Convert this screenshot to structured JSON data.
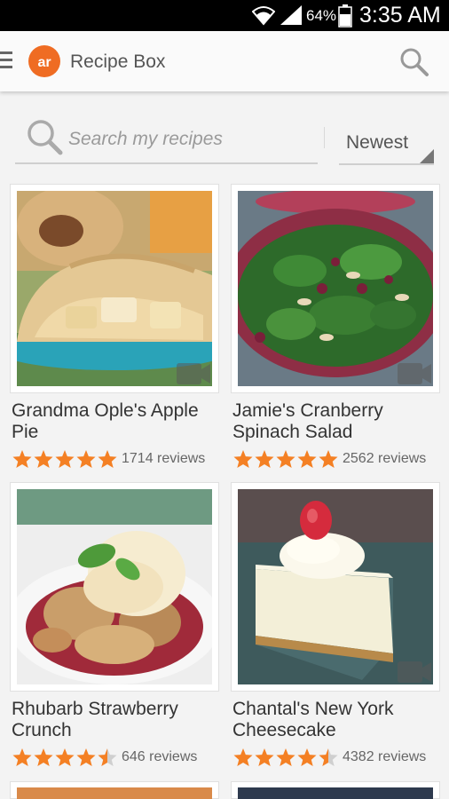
{
  "status_bar": {
    "battery_percent": "64%",
    "time": "3:35 AM"
  },
  "app_bar": {
    "title": "Recipe Box"
  },
  "search": {
    "placeholder": "Search my recipes"
  },
  "sort": {
    "selected": "Newest"
  },
  "colors": {
    "brand": "#ef6c23",
    "star": "#f48024",
    "star_empty": "#cfcfcf"
  },
  "recipes": [
    {
      "name": "Grandma Ople's Apple Pie",
      "rating": 5,
      "reviews": "1714 reviews",
      "has_video": true
    },
    {
      "name": "Jamie's Cranberry Spinach Salad",
      "rating": 5,
      "reviews": "2562 reviews",
      "has_video": true
    },
    {
      "name": "Rhubarb Strawberry Crunch",
      "rating": 4.5,
      "reviews": "646 reviews",
      "has_video": false
    },
    {
      "name": "Chantal's New York Cheesecake",
      "rating": 4.5,
      "reviews": "4382 reviews",
      "has_video": true
    }
  ]
}
